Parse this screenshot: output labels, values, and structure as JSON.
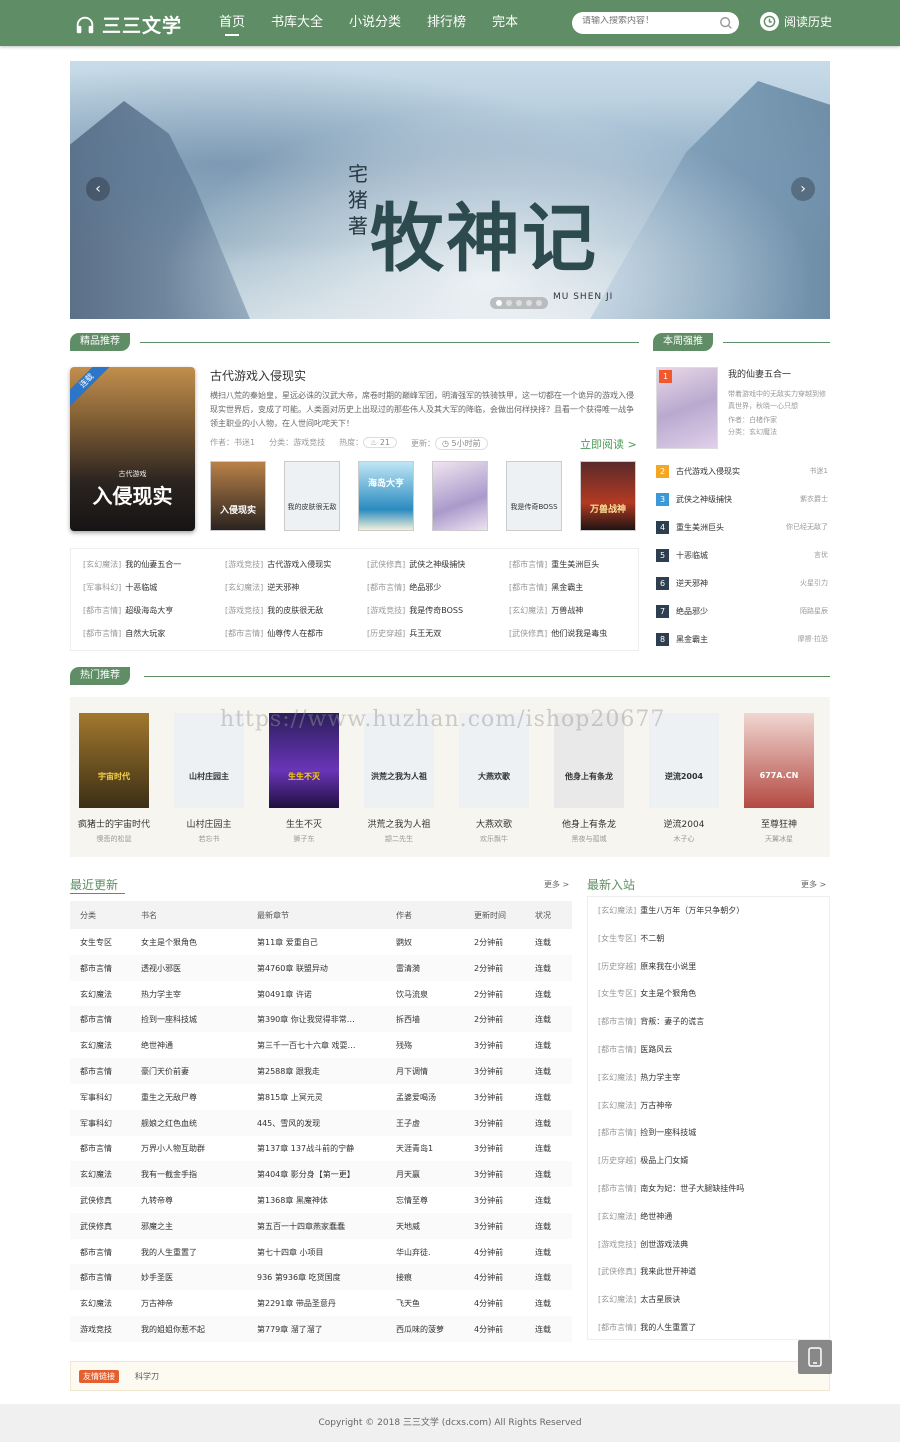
{
  "header": {
    "logo_text": "三三文学",
    "nav": [
      "首页",
      "书库大全",
      "小说分类",
      "排行榜",
      "完本"
    ],
    "search_placeholder": "请输入搜索内容！",
    "history_label": "阅读历史"
  },
  "banner": {
    "author": "宅猪著",
    "title": "牧神记",
    "subtitle": "MU SHEN JI",
    "prev": "‹",
    "next": "›"
  },
  "featured": {
    "section_label": "精品推荐",
    "ribbon": "连载",
    "cover_small": "古代游戏",
    "cover_title": "入侵现实",
    "title": "古代游戏入侵现实",
    "desc": "横扫八荒的秦始皇，星远必诛的汉武大帝，席卷时期的巅峰军团，明清强军的铁骑铁甲，这一切都在一个诡异的游戏入侵现实世界后，变成了可能。人类面对历史上出现过的那些伟人及其大军的降临，会做出何样抉择？且看一个获得唯一战争领主职业的小人物，在人世间叱咤天下！",
    "meta_author": "作者：书迷1",
    "meta_cat": "分类：游戏竞技",
    "meta_hot_label": "热度：",
    "meta_hot": "21",
    "meta_update_label": "更新：",
    "meta_update": "5小时前",
    "read_now": "立即阅读 >",
    "thumbs": [
      "入侵现实",
      "我的皮肤很无敌",
      "海岛大亨",
      "",
      "我是传奇BOSS",
      "万兽战神"
    ],
    "list": [
      {
        "cat": "[玄幻魔法]",
        "title": "我的仙妻五合一"
      },
      {
        "cat": "[游戏竞技]",
        "title": "古代游戏入侵现实"
      },
      {
        "cat": "[武侠修真]",
        "title": "武侠之神级捕快"
      },
      {
        "cat": "[都市言情]",
        "title": "重生美洲巨头"
      },
      {
        "cat": "[军事科幻]",
        "title": "十恶临城"
      },
      {
        "cat": "[玄幻魔法]",
        "title": "逆天邪神"
      },
      {
        "cat": "[都市言情]",
        "title": "绝品邪少"
      },
      {
        "cat": "[都市言情]",
        "title": "黑金霸主"
      },
      {
        "cat": "[都市言情]",
        "title": "超级海岛大亨"
      },
      {
        "cat": "[游戏竞技]",
        "title": "我的皮肤很无敌"
      },
      {
        "cat": "[游戏竞技]",
        "title": "我是传奇BOSS"
      },
      {
        "cat": "[玄幻魔法]",
        "title": "万兽战神"
      },
      {
        "cat": "[都市言情]",
        "title": "自然大玩家"
      },
      {
        "cat": "[都市言情]",
        "title": "仙尊传人在都市"
      },
      {
        "cat": "[历史穿越]",
        "title": "兵王无双"
      },
      {
        "cat": "[武侠修真]",
        "title": "他们说我是毒虫"
      }
    ]
  },
  "weekly": {
    "section_label": "本周强推",
    "top": {
      "rank": "1",
      "title": "我的仙妻五合一",
      "desc": "带着游戏中的无敌实力穿越到修真世界，秋晓一心只想",
      "author": "作者：白楮作家",
      "cat": "分类：玄幻魔法"
    },
    "rows": [
      {
        "rank": "2",
        "title": "古代游戏入侵现实",
        "author": "书迷1"
      },
      {
        "rank": "3",
        "title": "武侠之神级捕快",
        "author": "紫衣爵士"
      },
      {
        "rank": "4",
        "title": "重生美洲巨头",
        "author": "你已经无敌了"
      },
      {
        "rank": "5",
        "title": "十恶临城",
        "author": "言优"
      },
      {
        "rank": "6",
        "title": "逆天邪神",
        "author": "火星引力"
      },
      {
        "rank": "7",
        "title": "绝品邪少",
        "author": "陌路星辰"
      },
      {
        "rank": "8",
        "title": "黑金霸主",
        "author": "摩擦·拉恐"
      }
    ]
  },
  "hot": {
    "section_label": "热门推荐",
    "watermark": "https://www.huzhan.com/ishop20677",
    "items": [
      {
        "name": "疯猪士的宇宙时代",
        "author": "懊悲的松鼠",
        "cover": "宇宙时代"
      },
      {
        "name": "山村庄园主",
        "author": "若忘书",
        "cover": "山村庄园主"
      },
      {
        "name": "生生不灭",
        "author": "狮子东",
        "cover": "生生不灭"
      },
      {
        "name": "洪荒之我为人祖",
        "author": "颛二先生",
        "cover": "洪荒之我为人祖"
      },
      {
        "name": "大燕欢歌",
        "author": "欢乐飘牛",
        "cover": "大燕欢歌"
      },
      {
        "name": "他身上有条龙",
        "author": "黑夜与孤城",
        "cover": "他身上有条龙"
      },
      {
        "name": "逆流2004",
        "author": "木子心",
        "cover": "逆流2004"
      },
      {
        "name": "至尊狂神",
        "author": "天翼冰星",
        "cover": "677A.CN"
      }
    ]
  },
  "recent": {
    "title": "最近更新",
    "more": "更多 >",
    "headers": [
      "分类",
      "书名",
      "最新章节",
      "作者",
      "更新时间",
      "状况"
    ],
    "rows": [
      [
        "女生专区",
        "女主是个狠角色",
        "第11章 爱重自己",
        "鹦奴",
        "2分钟前",
        "连载"
      ],
      [
        "都市言情",
        "透视小邪医",
        "第4760章 联盟异动",
        "雷清漪",
        "2分钟前",
        "连载"
      ],
      [
        "玄幻魔法",
        "热力学主宰",
        "第0491章 许诺",
        "饮马流泉",
        "2分钟前",
        "连载"
      ],
      [
        "都市言情",
        "捡到一座科技城",
        "第390章 你让我觉得非常…",
        "拆西墙",
        "2分钟前",
        "连载"
      ],
      [
        "玄幻魔法",
        "绝世神通",
        "第三千一百七十六章 戏耍…",
        "残殇",
        "3分钟前",
        "连载"
      ],
      [
        "都市言情",
        "豪门天价前妻",
        "第2588章 跟我走",
        "月下调情",
        "3分钟前",
        "连载"
      ],
      [
        "军事科幻",
        "重生之无敌尸尊",
        "第815章 上冥元灵",
        "孟婆爱喝汤",
        "3分钟前",
        "连载"
      ],
      [
        "军事科幻",
        "舰娘之红色血统",
        "445、雪风的发现",
        "王子虚",
        "3分钟前",
        "连载"
      ],
      [
        "都市言情",
        "万界小人物互助群",
        "第137章 137战斗前的宁静",
        "天涯青岛1",
        "3分钟前",
        "连载"
      ],
      [
        "玄幻魔法",
        "我有一截金手指",
        "第404章 影分身【第一更】",
        "月天赢",
        "3分钟前",
        "连载"
      ],
      [
        "武侠修真",
        "九转帝尊",
        "第1368章 黑魔神体",
        "忘情至尊",
        "3分钟前",
        "连载"
      ],
      [
        "武侠修真",
        "邪魔之主",
        "第五百一十四章燕家蠢蠢",
        "天地威",
        "3分钟前",
        "连载"
      ],
      [
        "都市言情",
        "我的人生重置了",
        "第七十四章 小项目",
        "华山弃徒.",
        "4分钟前",
        "连载"
      ],
      [
        "都市言情",
        "妙手圣医",
        "936 第936章 吃货国度",
        "接痕",
        "4分钟前",
        "连载"
      ],
      [
        "玄幻魔法",
        "万古神帝",
        "第2291章 带品圣意丹",
        "飞天鱼",
        "4分钟前",
        "连载"
      ],
      [
        "游戏竞技",
        "我的姐姐你惹不起",
        "第779章 溜了溜了",
        "西瓜味的菠萝",
        "4分钟前",
        "连载"
      ]
    ]
  },
  "latest": {
    "title": "最新入站",
    "more": "更多 >",
    "rows": [
      {
        "cat": "[玄幻魔法]",
        "title": "重生八万年（万年只争朝夕）"
      },
      {
        "cat": "[女生专区]",
        "title": "不二朝"
      },
      {
        "cat": "[历史穿越]",
        "title": "原来我在小说里"
      },
      {
        "cat": "[女生专区]",
        "title": "女主是个狠角色"
      },
      {
        "cat": "[都市言情]",
        "title": "背叛：妻子的谎言"
      },
      {
        "cat": "[都市言情]",
        "title": "医路风云"
      },
      {
        "cat": "[玄幻魔法]",
        "title": "热力学主宰"
      },
      {
        "cat": "[玄幻魔法]",
        "title": "万古神帝"
      },
      {
        "cat": "[都市言情]",
        "title": "捡到一座科技城"
      },
      {
        "cat": "[历史穿越]",
        "title": "极品上门女婿"
      },
      {
        "cat": "[都市言情]",
        "title": "南女为妃：世子大腿缺挂件吗"
      },
      {
        "cat": "[玄幻魔法]",
        "title": "绝世神通"
      },
      {
        "cat": "[游戏竞技]",
        "title": "创世游戏法典"
      },
      {
        "cat": "[武侠修真]",
        "title": "我来此世开神道"
      },
      {
        "cat": "[玄幻魔法]",
        "title": "太古星辰诀"
      },
      {
        "cat": "[都市言情]",
        "title": "我的人生重置了"
      }
    ]
  },
  "friend": {
    "tag": "友情链接",
    "link": "科学刀"
  },
  "footer": {
    "text": "Copyright © 2018 三三文学 (dcxs.com) All Rights Reserved"
  },
  "colors": {
    "brand": "#5f8d65",
    "rank_top": "#f3582d",
    "rank_mid": "#f5a623",
    "rank_blue": "#3a9ad9",
    "rank_rest": "#2c3e50"
  }
}
